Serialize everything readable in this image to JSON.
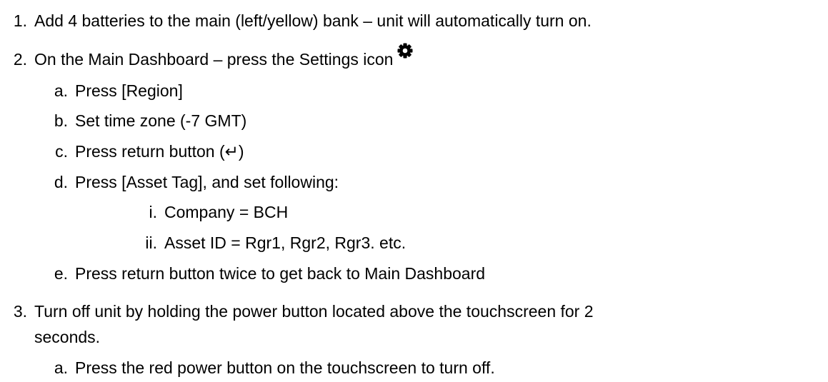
{
  "steps": [
    {
      "number": "1.",
      "text": "Add 4 batteries to the main (left/yellow) bank – unit will automatically turn on."
    },
    {
      "number": "2.",
      "text": "On the Main Dashboard – press the Settings icon",
      "icon": "gear-icon",
      "substeps": [
        {
          "marker": "a.",
          "text": "Press [Region]"
        },
        {
          "marker": "b.",
          "text": "Set time zone (-7 GMT)"
        },
        {
          "marker": "c.",
          "text": "Press return button (↵)"
        },
        {
          "marker": "d.",
          "text": "Press [Asset Tag], and set following:",
          "items": [
            {
              "marker": "i.",
              "text": "Company = BCH"
            },
            {
              "marker": "ii.",
              "text": "Asset ID = Rgr1, Rgr2, Rgr3. etc."
            }
          ]
        },
        {
          "marker": "e.",
          "text": "Press return button twice to get back to Main Dashboard"
        }
      ]
    },
    {
      "number": "3.",
      "text": "Turn off unit by holding the power button located above the touchscreen for 2",
      "text_continued": "seconds.",
      "substeps": [
        {
          "marker": "a.",
          "text": "Press the red power button on the touchscreen to turn off."
        }
      ]
    }
  ]
}
